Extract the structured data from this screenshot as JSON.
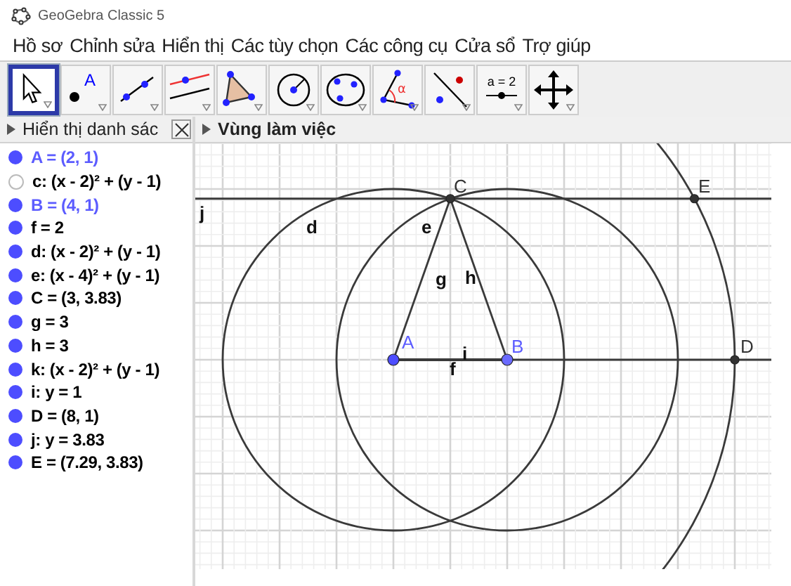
{
  "window": {
    "title": "GeoGebra Classic 5"
  },
  "menu": [
    "Hồ sơ",
    "Chỉnh sửa",
    "Hiển thị",
    "Các tùy chọn",
    "Các công cụ",
    "Cửa sổ",
    "Trợ giúp"
  ],
  "toolbar": [
    {
      "kind": "move",
      "selected": true
    },
    {
      "kind": "point",
      "selected": false,
      "text": "A"
    },
    {
      "kind": "line",
      "selected": false
    },
    {
      "kind": "parallel",
      "selected": false
    },
    {
      "kind": "polygon",
      "selected": false
    },
    {
      "kind": "circle",
      "selected": false
    },
    {
      "kind": "conic",
      "selected": false
    },
    {
      "kind": "angle",
      "selected": false,
      "text": "α"
    },
    {
      "kind": "reflect",
      "selected": false
    },
    {
      "kind": "slider",
      "selected": false,
      "text": "a = 2"
    },
    {
      "kind": "pan",
      "selected": false
    }
  ],
  "algebra_panel": {
    "title": "Hiển thị danh sác",
    "items": [
      {
        "text": "A = (2, 1)",
        "visible": true,
        "color": "#5c5cff"
      },
      {
        "text": "c: (x - 2)² + (y - 1)",
        "visible": false,
        "color": "#000000"
      },
      {
        "text": "B = (4, 1)",
        "visible": true,
        "color": "#5c5cff"
      },
      {
        "text": "f = 2",
        "visible": true,
        "color": "#000000"
      },
      {
        "text": "d: (x - 2)² + (y - 1)",
        "visible": true,
        "color": "#000000"
      },
      {
        "text": "e: (x - 4)² + (y - 1)",
        "visible": true,
        "color": "#000000"
      },
      {
        "text": "C = (3, 3.83)",
        "visible": true,
        "color": "#000000"
      },
      {
        "text": "g = 3",
        "visible": true,
        "color": "#000000"
      },
      {
        "text": "h = 3",
        "visible": true,
        "color": "#000000"
      },
      {
        "text": "k: (x - 2)² + (y - 1)",
        "visible": true,
        "color": "#000000"
      },
      {
        "text": "i: y = 1",
        "visible": true,
        "color": "#000000"
      },
      {
        "text": "D = (8, 1)",
        "visible": true,
        "color": "#000000"
      },
      {
        "text": "j: y = 3.83",
        "visible": true,
        "color": "#000000"
      },
      {
        "text": "E = (7.29, 3.83)",
        "visible": true,
        "color": "#000000"
      }
    ]
  },
  "graphics_panel": {
    "title": "Vùng làm việc",
    "labels": [
      {
        "text": "j",
        "kind": "object"
      },
      {
        "text": "d",
        "kind": "object"
      },
      {
        "text": "e",
        "kind": "object"
      },
      {
        "text": "C",
        "kind": "point"
      },
      {
        "text": "E",
        "kind": "point"
      },
      {
        "text": "g",
        "kind": "object"
      },
      {
        "text": "h",
        "kind": "object"
      },
      {
        "text": "A",
        "kind": "free-point"
      },
      {
        "text": "B",
        "kind": "free-point"
      },
      {
        "text": "i",
        "kind": "object"
      },
      {
        "text": "f",
        "kind": "object"
      },
      {
        "text": "D",
        "kind": "point"
      }
    ]
  }
}
